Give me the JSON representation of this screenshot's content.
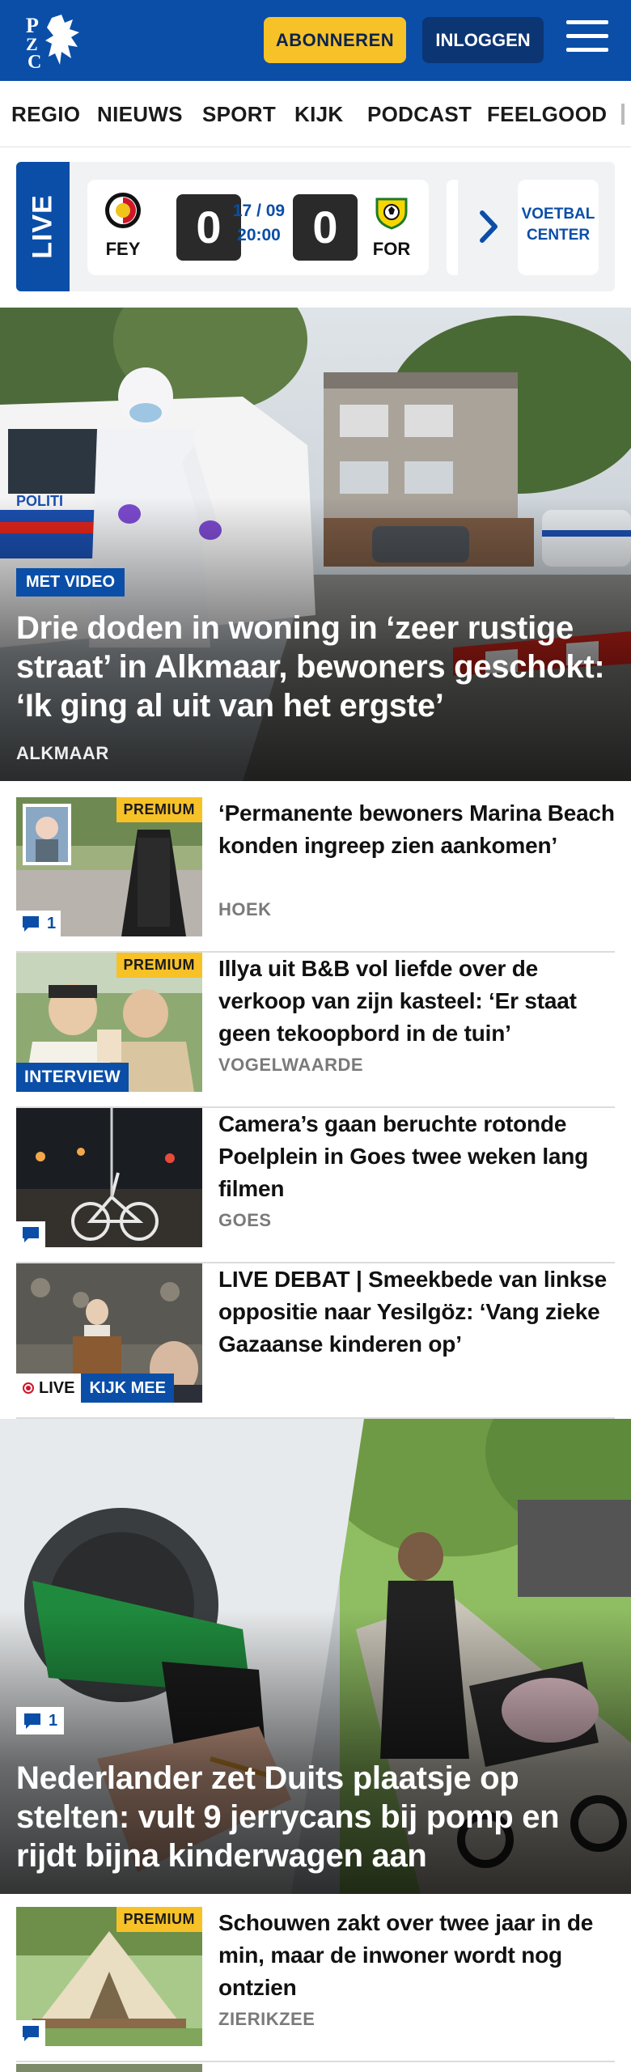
{
  "header": {
    "logo_text": "PZC",
    "subscribe_label": "ABONNEREN",
    "login_label": "INLOGGEN",
    "menu_icon": "hamburger-menu-icon",
    "brand_color": "#0a4ea8",
    "accent_color": "#f7c128"
  },
  "nav": {
    "items": [
      "REGIO",
      "NIEUWS",
      "SPORT",
      "KIJK",
      "PODCAST",
      "FEELGOOD"
    ]
  },
  "live": {
    "label": "LIVE",
    "home_team": "FEY",
    "away_team": "FOR",
    "home_score": "0",
    "away_score": "0",
    "date": "17 / 09",
    "time": "20:00",
    "voetbal_center_line1": "VOETBAL",
    "voetbal_center_line2": "CENTER"
  },
  "hero1": {
    "badge": "MET VIDEO",
    "title": "Drie doden in woning in ‘zeer rustige straat’ in Alkmaar, bewoners geschokt: ‘Ik ging al uit van het ergste’",
    "location": "ALKMAAR",
    "police_text": "POLITI"
  },
  "articles": [
    {
      "title": "‘Permanente bewoners Marina Beach konden ingreep zien aankomen’",
      "location": "HOEK",
      "premium": "PREMIUM",
      "comments": "1"
    },
    {
      "title": "Illya uit B&B vol liefde over de verkoop van zijn kasteel: ‘Er staat geen tekoopbord in de tuin’",
      "location": "VOGELWAARDE",
      "premium": "PREMIUM",
      "badge": "INTERVIEW"
    },
    {
      "title": "Camera’s gaan beruchte rotonde Poelplein in Goes twee weken lang filmen",
      "location": "GOES"
    },
    {
      "title": "LIVE DEBAT | Smeekbede van linkse oppositie naar Yesilgöz: ‘Vang zieke Gazaanse kinderen op’",
      "live_label": "LIVE",
      "watch_label": "KIJK MEE"
    }
  ],
  "hero2": {
    "title": "Nederlander zet Duits plaatsje op stelten: vult 9 jerrycans bij pomp en rijdt bijna kinderwagen aan",
    "comments": "1"
  },
  "article5": {
    "title": "Schouwen zakt over twee jaar in de min, maar de inwoner wordt nog ontzien",
    "location": "ZIERIKZEE",
    "premium": "PREMIUM"
  }
}
